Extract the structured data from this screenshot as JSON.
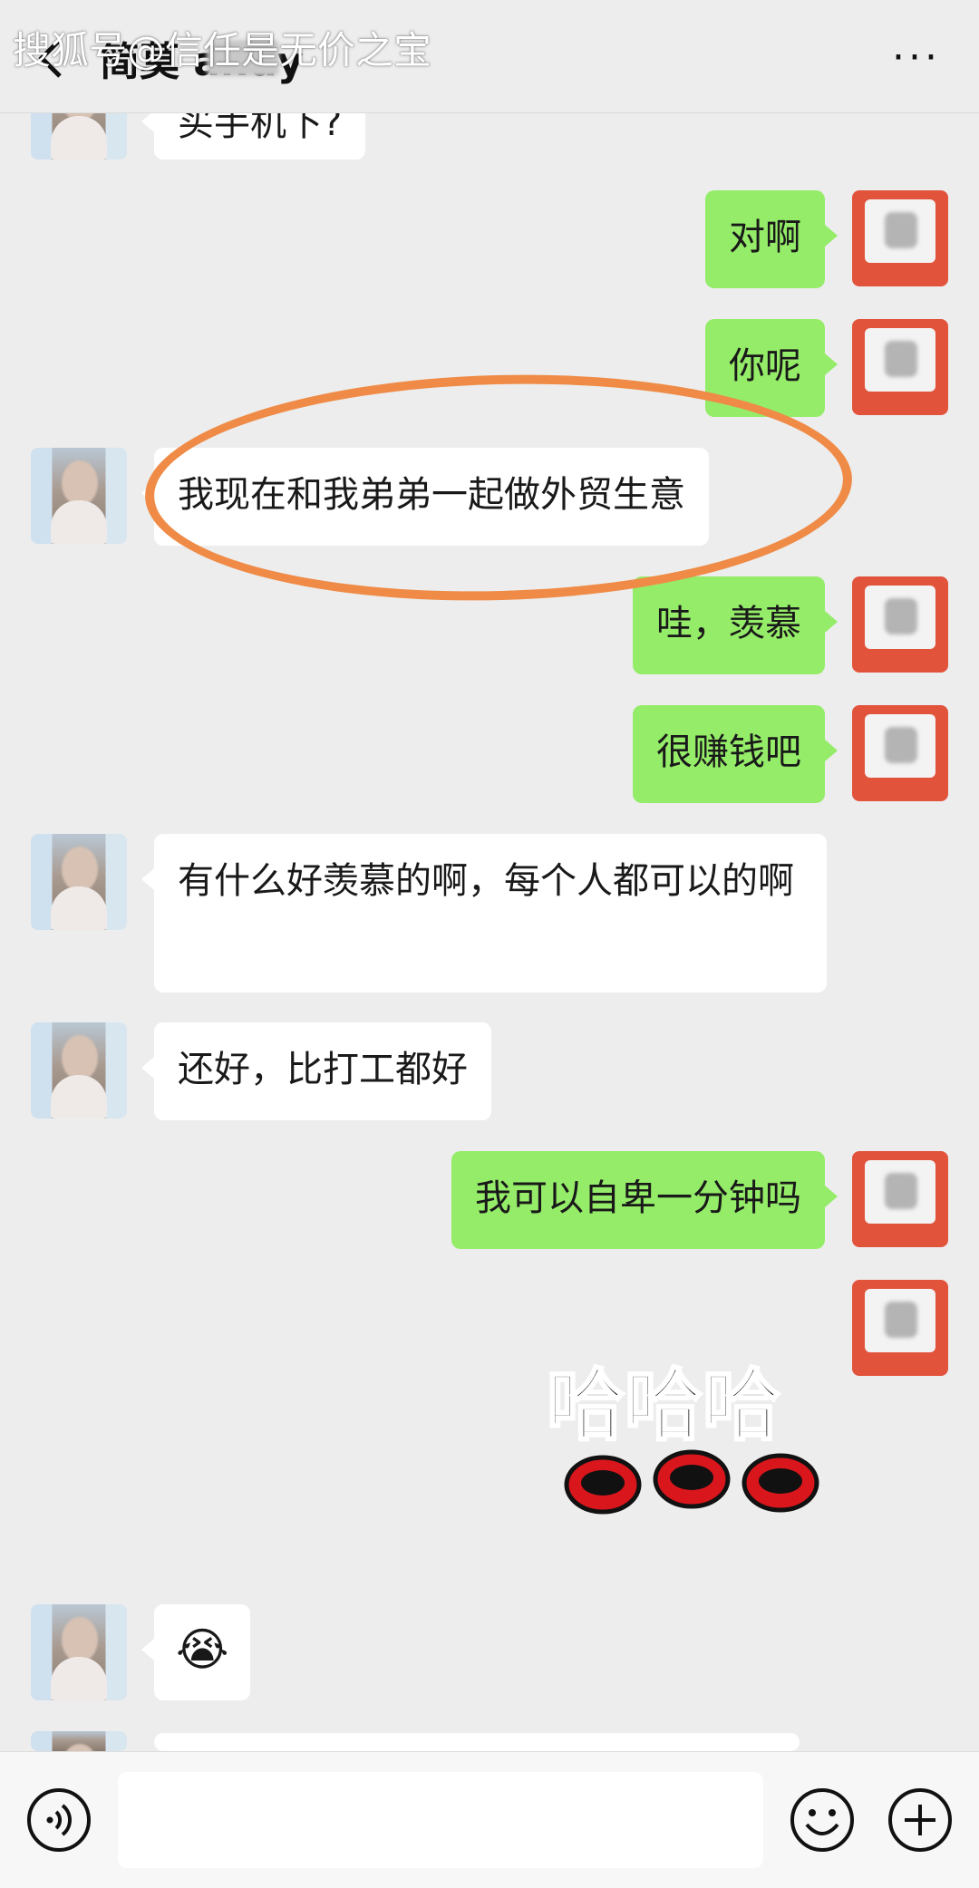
{
  "watermark": "搜狐号@信任是无价之宝",
  "header": {
    "title": "简莫 andy",
    "more_label": "···"
  },
  "messages": [
    {
      "side": "left",
      "text": "买手机下?"
    },
    {
      "side": "right",
      "text": "对啊"
    },
    {
      "side": "right",
      "text": "你呢"
    },
    {
      "side": "left",
      "text": "我现在和我弟弟一起做外贸生意"
    },
    {
      "side": "right",
      "text": "哇，羡慕"
    },
    {
      "side": "right",
      "text": "很赚钱吧"
    },
    {
      "side": "left",
      "text": "有什么好羡慕的啊，每个人都可以的啊"
    },
    {
      "side": "left",
      "text": "还好，比打工都好"
    },
    {
      "side": "right",
      "text": "我可以自卑一分钟吗"
    },
    {
      "side": "right",
      "sticker": "哈哈哈"
    },
    {
      "side": "left",
      "emoji": "😭"
    }
  ],
  "input": {
    "placeholder": ""
  },
  "colors": {
    "background": "#ededed",
    "sent_bubble": "#95ec69",
    "received_bubble": "#ffffff",
    "highlight_ellipse": "#ef8b46"
  }
}
